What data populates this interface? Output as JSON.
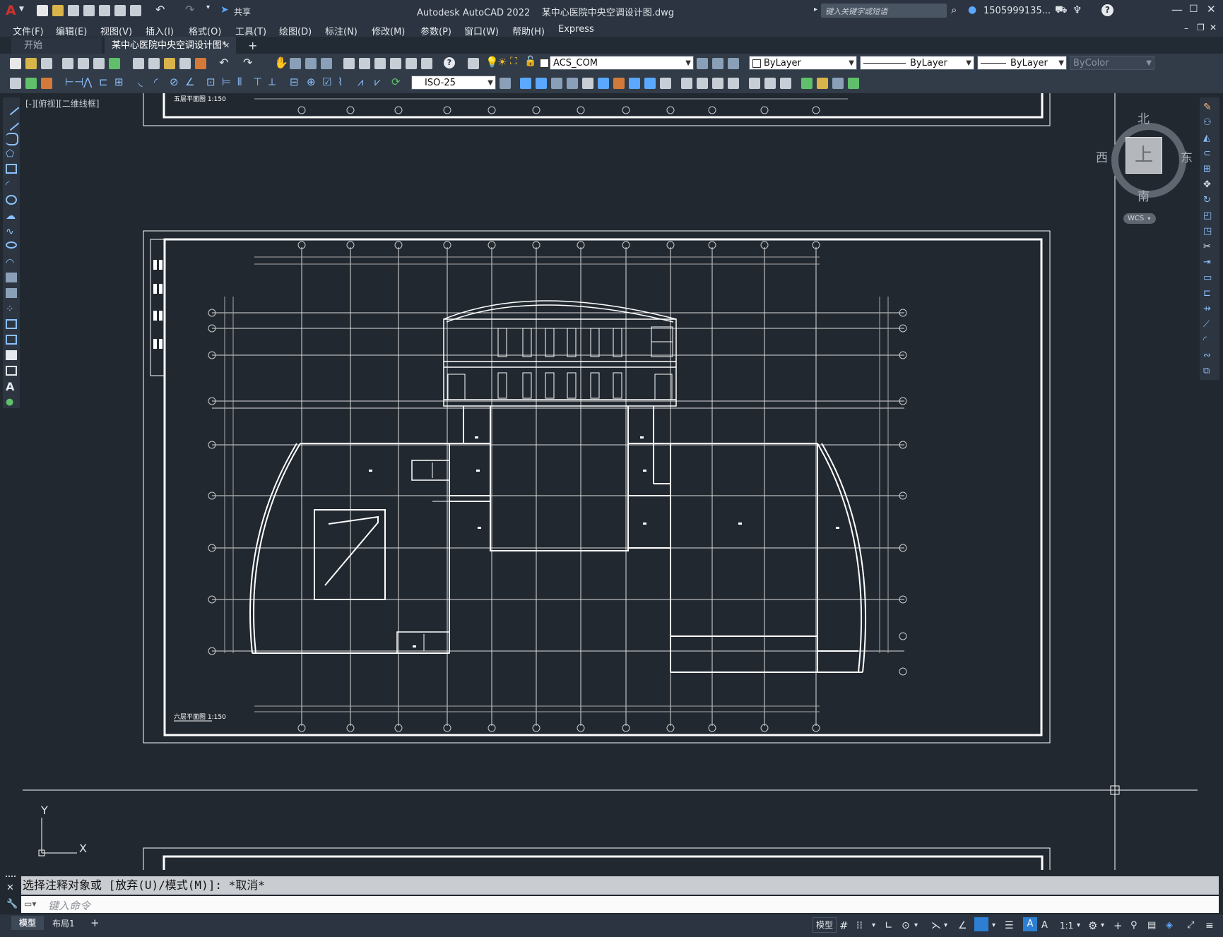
{
  "title_bar": {
    "app_logo": "A",
    "share_label": "共享",
    "title": "Autodesk AutoCAD 2022    某中心医院中央空调设计图.dwg",
    "search_placeholder": "键入关键字或短语",
    "user": "1505999135...",
    "help_icon": "?"
  },
  "menu": [
    "文件(F)",
    "编辑(E)",
    "视图(V)",
    "插入(I)",
    "格式(O)",
    "工具(T)",
    "绘图(D)",
    "标注(N)",
    "修改(M)",
    "参数(P)",
    "窗口(W)",
    "帮助(H)",
    "Express"
  ],
  "tabs": {
    "start": "开始",
    "drawing": "某中心医院中央空调设计图*",
    "close": "✕",
    "add": "+"
  },
  "toolbar": {
    "layer_name": "ACS_COM",
    "color_combo": "ByLayer",
    "linetype_combo": "ByLayer",
    "lineweight_combo": "ByLayer",
    "plotstyle_combo": "ByColor",
    "dimstyle_combo": "ISO-25"
  },
  "viewport": {
    "view_label": "[-][俯视][二维线框]",
    "viewcube": {
      "north": "北",
      "south": "南",
      "east": "东",
      "west": "西",
      "face": "上"
    },
    "wcs": "WCS",
    "ucs_x": "X",
    "ucs_y": "Y"
  },
  "drawing": {
    "upper_title": "五层平面图 1:150",
    "main_title": "六层平面图 1:150"
  },
  "command": {
    "history": "选择注释对象或 [放弃(U)/模式(M)]: *取消*",
    "input_placeholder": "键入命令"
  },
  "status": {
    "model_tab": "模型",
    "layout_tab": "布局1",
    "add_layout": "+",
    "model_button": "模型",
    "scale": "1:1"
  },
  "colors": {
    "background": "#212830",
    "accent": "#2d7fd3",
    "logo_red": "#d0312d"
  }
}
